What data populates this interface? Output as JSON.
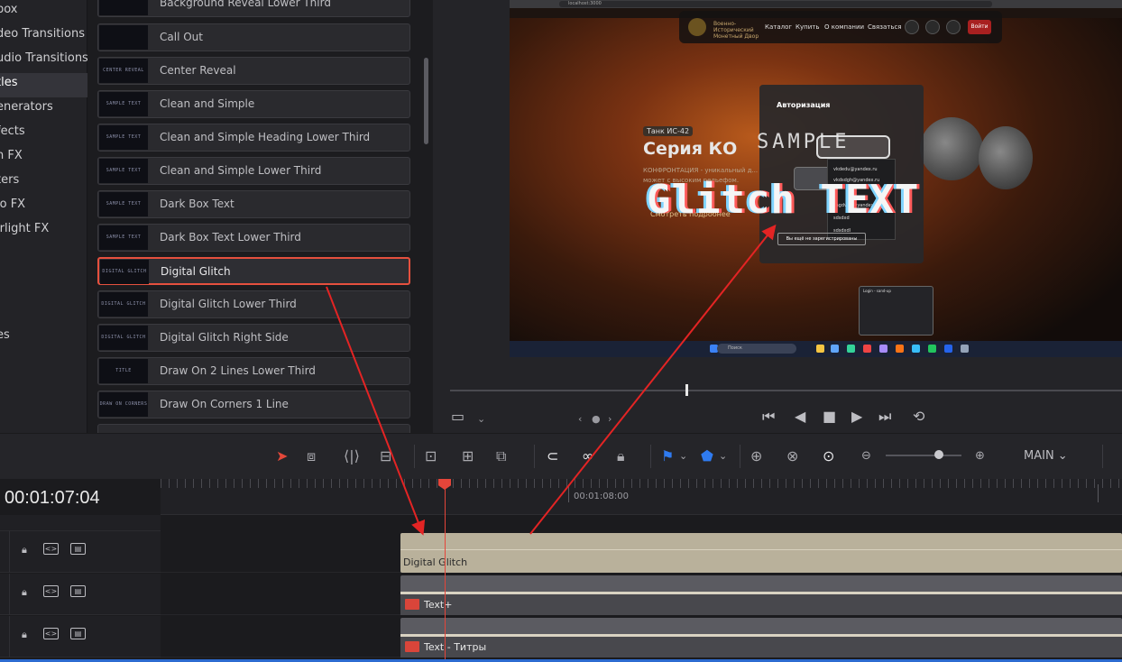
{
  "sidebar": {
    "categories": [
      {
        "label": "box"
      },
      {
        "label": "deo Transitions"
      },
      {
        "label": "udio Transitions"
      },
      {
        "label": "tles"
      },
      {
        "label": "enerators"
      },
      {
        "label": "fects"
      },
      {
        "label": "n FX"
      },
      {
        "label": "ters"
      },
      {
        "label": "io FX"
      },
      {
        "label": "irlight FX"
      },
      {
        "label": "es"
      }
    ]
  },
  "effects": {
    "items": [
      {
        "label": "Background Reveal Lower Third",
        "thumb": ""
      },
      {
        "label": "Call Out",
        "thumb": ""
      },
      {
        "label": "Center Reveal",
        "thumb": "CENTER REVEAL"
      },
      {
        "label": "Clean and Simple",
        "thumb": "SAMPLE TEXT"
      },
      {
        "label": "Clean and Simple Heading Lower Third",
        "thumb": "SAMPLE TEXT"
      },
      {
        "label": "Clean and Simple Lower Third",
        "thumb": "SAMPLE TEXT"
      },
      {
        "label": "Dark Box Text",
        "thumb": "SAMPLE TEXT"
      },
      {
        "label": "Dark Box Text Lower Third",
        "thumb": "SAMPLE TEXT"
      },
      {
        "label": "Digital Glitch",
        "thumb": "DIGITAL GLITCH"
      },
      {
        "label": "Digital Glitch Lower Third",
        "thumb": "DIGITAL GLITCH"
      },
      {
        "label": "Digital Glitch Right Side",
        "thumb": "DIGITAL GLITCH"
      },
      {
        "label": "Draw On 2 Lines Lower Third",
        "thumb": "TITLE"
      },
      {
        "label": "Draw On Corners 1 Line",
        "thumb": "DRAW ON CORNERS"
      }
    ]
  },
  "viewer": {
    "url": "localhost:3000",
    "site": {
      "brand": "Военно-Исторический Монетный Двор",
      "nav": [
        "Каталог",
        "Купить",
        "О компании",
        "Связаться"
      ],
      "login": "Войти",
      "tank_tag": "Танк ИС-42",
      "series": "Серия КО",
      "desc": "КОНФРОНТАЦИЯ - уникальный д... может с высоким рельефом.",
      "link": "Смотреть подробнее",
      "modal_title": "Авторизация",
      "modal_emails": [
        "vkdedu@yandex.ru",
        "vkdsdgh@yandex.ru",
        "sagdvgh@yandex.ru",
        "sdsdxd",
        "sdsdxdl"
      ],
      "modal_btn": "Вы ещё не зарегистрированы",
      "popup_title": "Login - sand-up",
      "search": "Поиск"
    },
    "overlay_sample": "SAMPLE",
    "overlay_glitch": "Glitch TEXT"
  },
  "toolbar": {
    "main_label": "MAIN ⌄"
  },
  "timeline": {
    "timecode": "00:01:07:04",
    "ruler_label": "00:01:08:00",
    "clips": [
      {
        "label": "Digital Glitch"
      },
      {
        "label": "Text+"
      },
      {
        "label": "Text - Титры"
      }
    ]
  },
  "colors": {
    "accent_red": "#e5453a",
    "selection_border": "#e5503e",
    "beige_clip": "#b9b19b",
    "blue_marker": "#2f7bf0"
  }
}
